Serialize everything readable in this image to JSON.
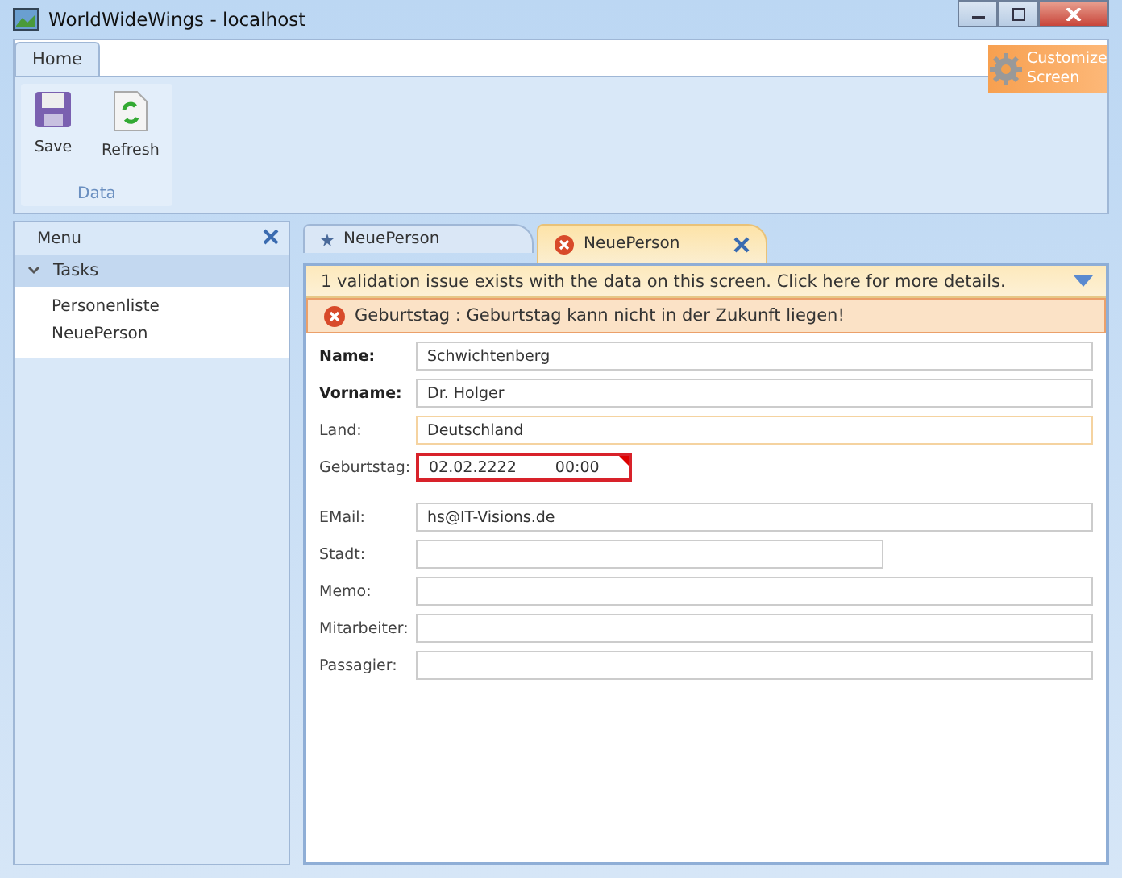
{
  "window": {
    "title": "WorldWideWings - localhost"
  },
  "ribbon": {
    "tabs": [
      {
        "label": "Home",
        "selected": true
      }
    ],
    "customize": {
      "line1": "Customize",
      "line2": "Screen"
    },
    "groups": [
      {
        "label": "Data",
        "buttons": [
          {
            "label": "Save",
            "kind": "save"
          },
          {
            "label": "Refresh",
            "kind": "refresh"
          }
        ]
      }
    ]
  },
  "menu": {
    "title": "Menu",
    "sections": [
      {
        "label": "Tasks",
        "expanded": true,
        "children": [
          {
            "label": "Personenliste"
          },
          {
            "label": "NeuePerson"
          }
        ]
      }
    ]
  },
  "tabs": [
    {
      "label": "NeuePerson",
      "selected": false,
      "has_error": false
    },
    {
      "label": "NeuePerson",
      "selected": true,
      "has_error": true
    }
  ],
  "validation": {
    "summary": "1 validation issue exists with the data on this screen. Click here for more details.",
    "issues": [
      "Geburtstag : Geburtstag kann nicht in der Zukunft liegen!"
    ]
  },
  "form": {
    "fields": [
      {
        "label": "Name:",
        "required": true,
        "kind": "text",
        "value": "Schwichtenberg",
        "focused": false,
        "invalid": false
      },
      {
        "label": "Vorname:",
        "required": true,
        "kind": "text",
        "value": "Dr. Holger",
        "focused": false,
        "invalid": false
      },
      {
        "label": "Land:",
        "required": false,
        "kind": "text",
        "value": "Deutschland",
        "focused": true,
        "invalid": false
      },
      {
        "label": "Geburtstag:",
        "required": false,
        "kind": "datetime",
        "value": "02.02.2222",
        "time": "00:00",
        "focused": false,
        "invalid": true
      },
      {
        "label": "EMail:",
        "required": false,
        "kind": "text",
        "value": "hs@IT-Visions.de",
        "focused": false,
        "invalid": false
      },
      {
        "label": "Stadt:",
        "required": false,
        "kind": "short",
        "focused": false,
        "invalid": false
      },
      {
        "label": "Memo:",
        "required": false,
        "kind": "text",
        "focused": false,
        "invalid": false
      },
      {
        "label": "Mitarbeiter:",
        "required": false,
        "kind": "text",
        "focused": false,
        "invalid": false
      },
      {
        "label": "Passagier:",
        "required": false,
        "kind": "text",
        "focused": false,
        "invalid": false
      }
    ]
  }
}
